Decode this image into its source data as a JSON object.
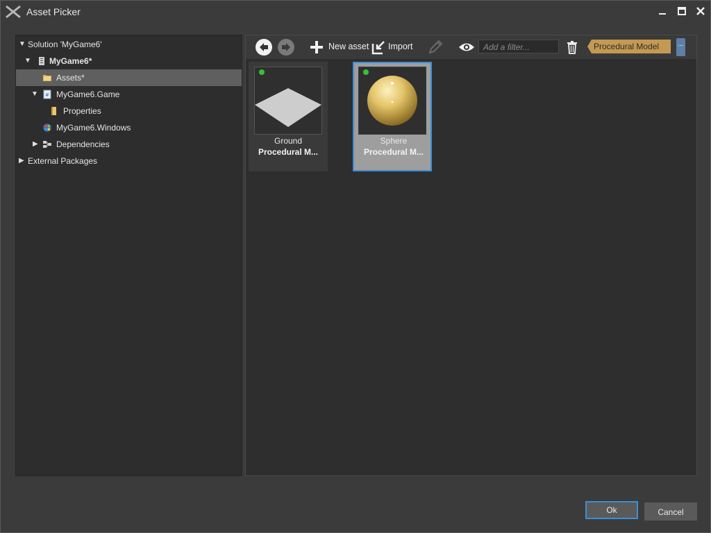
{
  "window": {
    "title": "Asset Picker",
    "min_icon": "minimize-icon",
    "max_icon": "maximize-icon",
    "close_icon": "close-icon"
  },
  "tree": [
    {
      "label": "Solution 'MyGame6'",
      "expanded": true,
      "icon": "none"
    },
    {
      "label": "MyGame6*",
      "expanded": true,
      "icon": "project-icon"
    },
    {
      "label": "Assets*",
      "icon": "folder-icon",
      "selected": true
    },
    {
      "label": "MyGame6.Game",
      "expanded": true,
      "icon": "csharp-file-icon"
    },
    {
      "label": "Properties",
      "icon": "folder-icon"
    },
    {
      "label": "MyGame6.Windows",
      "icon": "windows-logo-icon"
    },
    {
      "label": "Dependencies",
      "expanded": false,
      "icon": "dependencies-icon"
    },
    {
      "label": "External Packages",
      "expanded": false,
      "icon": "none"
    }
  ],
  "toolbar": {
    "new_asset": "New asset",
    "import": "Import",
    "filter_placeholder": "Add a filter...",
    "active_filter_tag": "Procedural Model",
    "more": "..."
  },
  "assets": [
    {
      "name": "Ground",
      "type": "Procedural M...",
      "selected": false
    },
    {
      "name": "Sphere",
      "type": "Procedural M...",
      "selected": true
    }
  ],
  "buttons": {
    "ok": "Ok",
    "cancel": "Cancel"
  },
  "colors": {
    "selection_border": "#3d8fd6",
    "tag_bg": "#c49a52",
    "status_dot": "#39c039"
  }
}
